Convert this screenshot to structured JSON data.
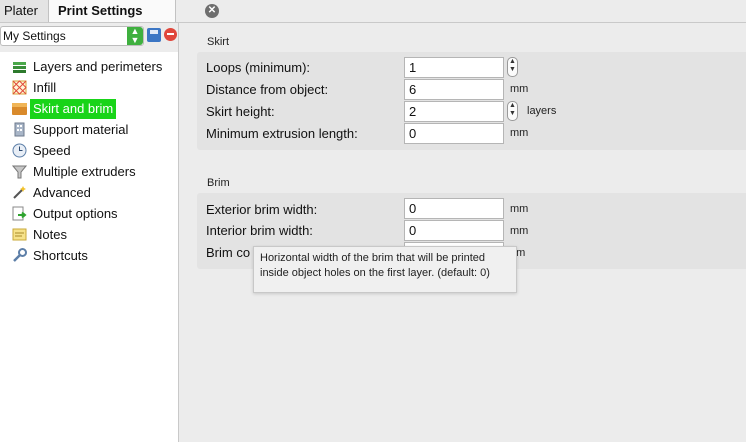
{
  "tabs": [
    {
      "label": "Plater"
    },
    {
      "label": "Print Settings"
    }
  ],
  "preset": {
    "selected": "My Settings"
  },
  "sidebar": {
    "items": [
      {
        "label": "Layers and perimeters",
        "icon": "layers-icon"
      },
      {
        "label": "Infill",
        "icon": "infill-icon"
      },
      {
        "label": "Skirt and brim",
        "icon": "box-icon",
        "selected": true
      },
      {
        "label": "Support material",
        "icon": "building-icon"
      },
      {
        "label": "Speed",
        "icon": "clock-icon"
      },
      {
        "label": "Multiple extruders",
        "icon": "funnel-icon"
      },
      {
        "label": "Advanced",
        "icon": "wand-icon"
      },
      {
        "label": "Output options",
        "icon": "export-icon"
      },
      {
        "label": "Notes",
        "icon": "note-icon"
      },
      {
        "label": "Shortcuts",
        "icon": "wrench-icon"
      }
    ]
  },
  "skirt": {
    "title": "Skirt",
    "loops": {
      "label": "Loops (minimum):",
      "value": "1"
    },
    "distance": {
      "label": "Distance from object:",
      "value": "6",
      "unit": "mm"
    },
    "height": {
      "label": "Skirt height:",
      "value": "2",
      "unit": "layers"
    },
    "min_length": {
      "label": "Minimum extrusion length:",
      "value": "0",
      "unit": "mm"
    }
  },
  "brim": {
    "title": "Brim",
    "exterior": {
      "label": "Exterior brim width:",
      "value": "0",
      "unit": "mm"
    },
    "interior": {
      "label": "Interior brim width:",
      "value": "0",
      "unit": "mm"
    },
    "connections": {
      "label": "Brim co",
      "unit": "nm"
    }
  },
  "tooltip": {
    "line1": "Horizontal width of the brim that will be printed",
    "line2": "inside object holes on the first layer. (default: 0)"
  },
  "colors": {
    "selection": "#19d419",
    "preset_arrow": "#3fb03f",
    "delete": "#e0463b",
    "save": "#3b76c4"
  }
}
